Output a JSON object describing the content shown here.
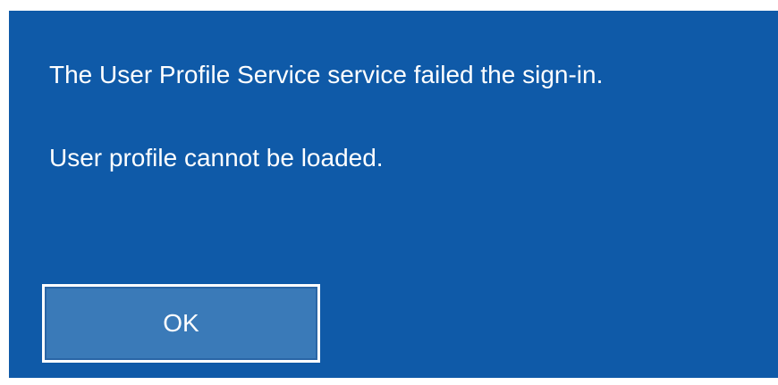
{
  "dialog": {
    "message_line1": "The User Profile Service service failed the sign-in.",
    "message_line2": "User profile cannot be loaded.",
    "ok_label": "OK"
  },
  "colors": {
    "dialog_background": "#0f5aa8",
    "button_background": "#3a7ab8",
    "text": "#ffffff",
    "page_background": "#ffffff"
  }
}
